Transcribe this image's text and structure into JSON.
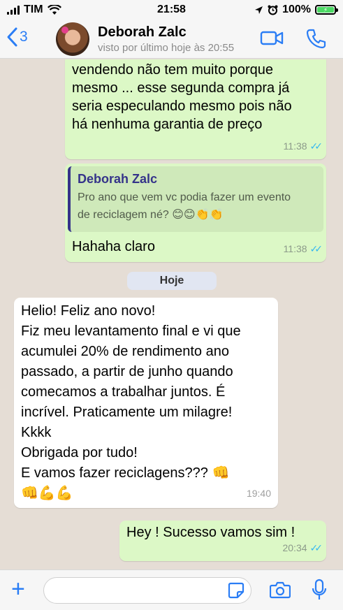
{
  "status_bar": {
    "carrier": "TIM",
    "time": "21:58",
    "battery": "100%"
  },
  "header": {
    "back_count": "3",
    "contact_name": "Deborah Zalc",
    "last_seen": "visto por último hoje às 20:55"
  },
  "messages": [
    {
      "direction": "out",
      "text": "vendendo não tem muito porque\nmesmo ... esse segunda compra já\nseria especulando mesmo pois não\nhá nenhuma garantia de preço",
      "time": "11:38",
      "read": true
    },
    {
      "direction": "out",
      "quoted_name": "Deborah Zalc",
      "quoted_text": "Pro ano que vem vc podia fazer um evento\nde reciclagem né? 😊😊👏👏",
      "text": "Hahaha claro",
      "time": "11:38",
      "read": true
    },
    {
      "direction": "in",
      "text": "Helio! Feliz ano novo!\nFiz meu levantamento final e vi que\nacumulei 20% de rendimento ano\npassado, a partir de junho quando\ncomecamos a trabalhar juntos. É\nincrível. Praticamente um milagre!\nKkkk\nObrigada por tudo!\nE vamos fazer reciclagens??? 👊\n👊💪💪",
      "time": "19:40"
    },
    {
      "direction": "out",
      "text": "Hey ! Sucesso vamos sim !",
      "time": "20:34",
      "read": true
    }
  ],
  "day_separator": "Hoje",
  "input": {
    "placeholder": ""
  },
  "colors": {
    "accent": "#2a7df5",
    "outgoing_bubble": "#dcf8c6",
    "incoming_bubble": "#ffffff",
    "chat_background": "#e5ddd5",
    "read_ticks": "#34b7f1",
    "quote_name": "#35338a"
  }
}
